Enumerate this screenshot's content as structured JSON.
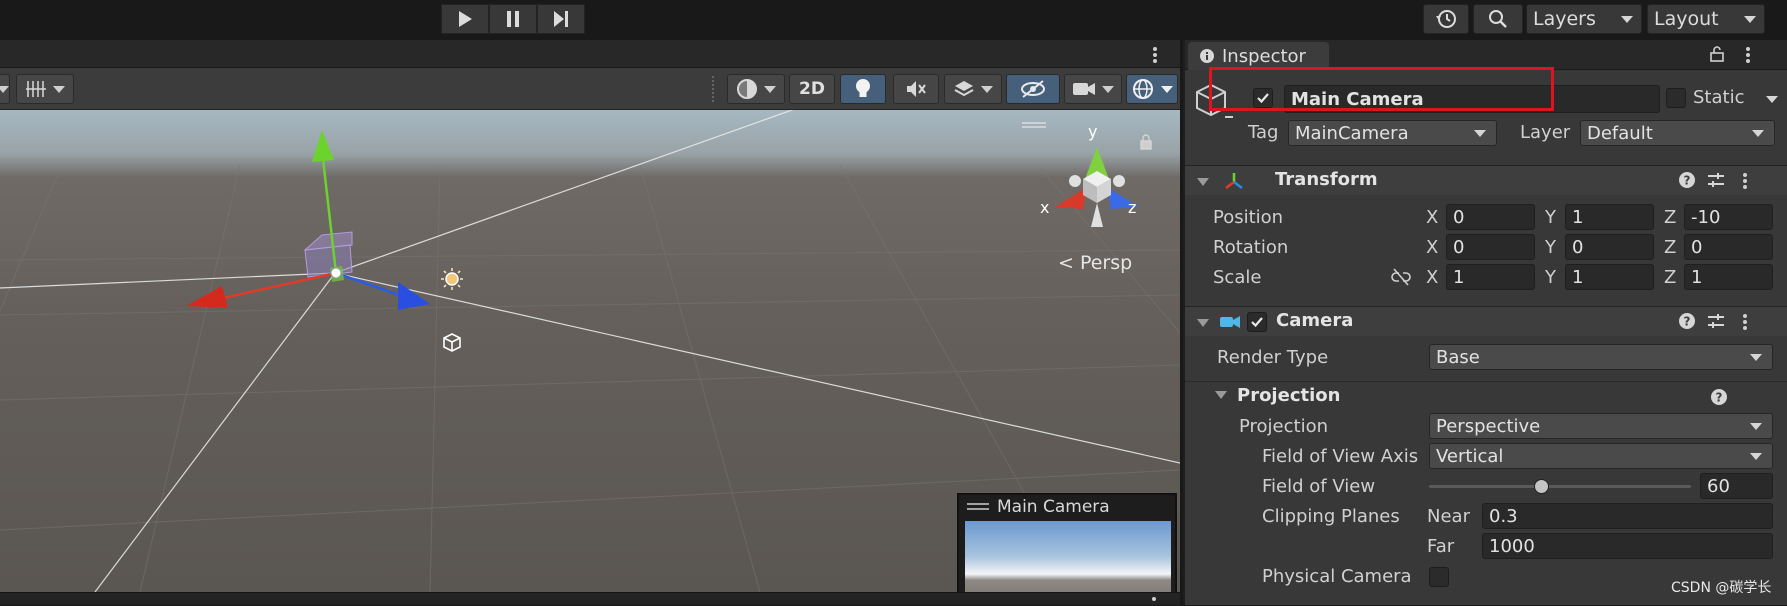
{
  "colors": {
    "accent_blue": "#46607c",
    "highlight_red": "#e0141e",
    "axis_x": "#e23a2a",
    "axis_y": "#6cd22e",
    "axis_z": "#2a5ae8"
  },
  "toolbar": {
    "layers_label": "Layers",
    "layout_label": "Layout",
    "icons": [
      "play-icon",
      "pause-icon",
      "step-icon",
      "history-icon",
      "search-icon"
    ]
  },
  "scene": {
    "btn_2d": "2D",
    "persp_label": "< Persp",
    "axis_x": "x",
    "axis_y": "y",
    "axis_z": "z",
    "preview_title": "Main Camera"
  },
  "inspector": {
    "tab_label": "Inspector",
    "object_name": "Main Camera",
    "static_label": "Static",
    "tag_label": "Tag",
    "tag_value": "MainCamera",
    "layer_label": "Layer",
    "layer_value": "Default",
    "transform": {
      "title": "Transform",
      "rows": [
        {
          "label": "Position",
          "x": "0",
          "y": "1",
          "z": "-10"
        },
        {
          "label": "Rotation",
          "x": "0",
          "y": "0",
          "z": "0"
        },
        {
          "label": "Scale",
          "x": "1",
          "y": "1",
          "z": "1"
        }
      ],
      "axis_labels": [
        "X",
        "Y",
        "Z"
      ]
    },
    "camera": {
      "title": "Camera",
      "render_type_label": "Render Type",
      "render_type_value": "Base",
      "projection_header": "Projection",
      "projection_label": "Projection",
      "projection_value": "Perspective",
      "fov_axis_label": "Field of View Axis",
      "fov_axis_value": "Vertical",
      "fov_label": "Field of View",
      "fov_value": "60",
      "fov_fraction": 0.43,
      "clipping_label": "Clipping Planes",
      "near_label": "Near",
      "near_value": "0.3",
      "far_label": "Far",
      "far_value": "1000",
      "physical_label": "Physical Camera"
    }
  },
  "watermark": "CSDN @碳学长"
}
